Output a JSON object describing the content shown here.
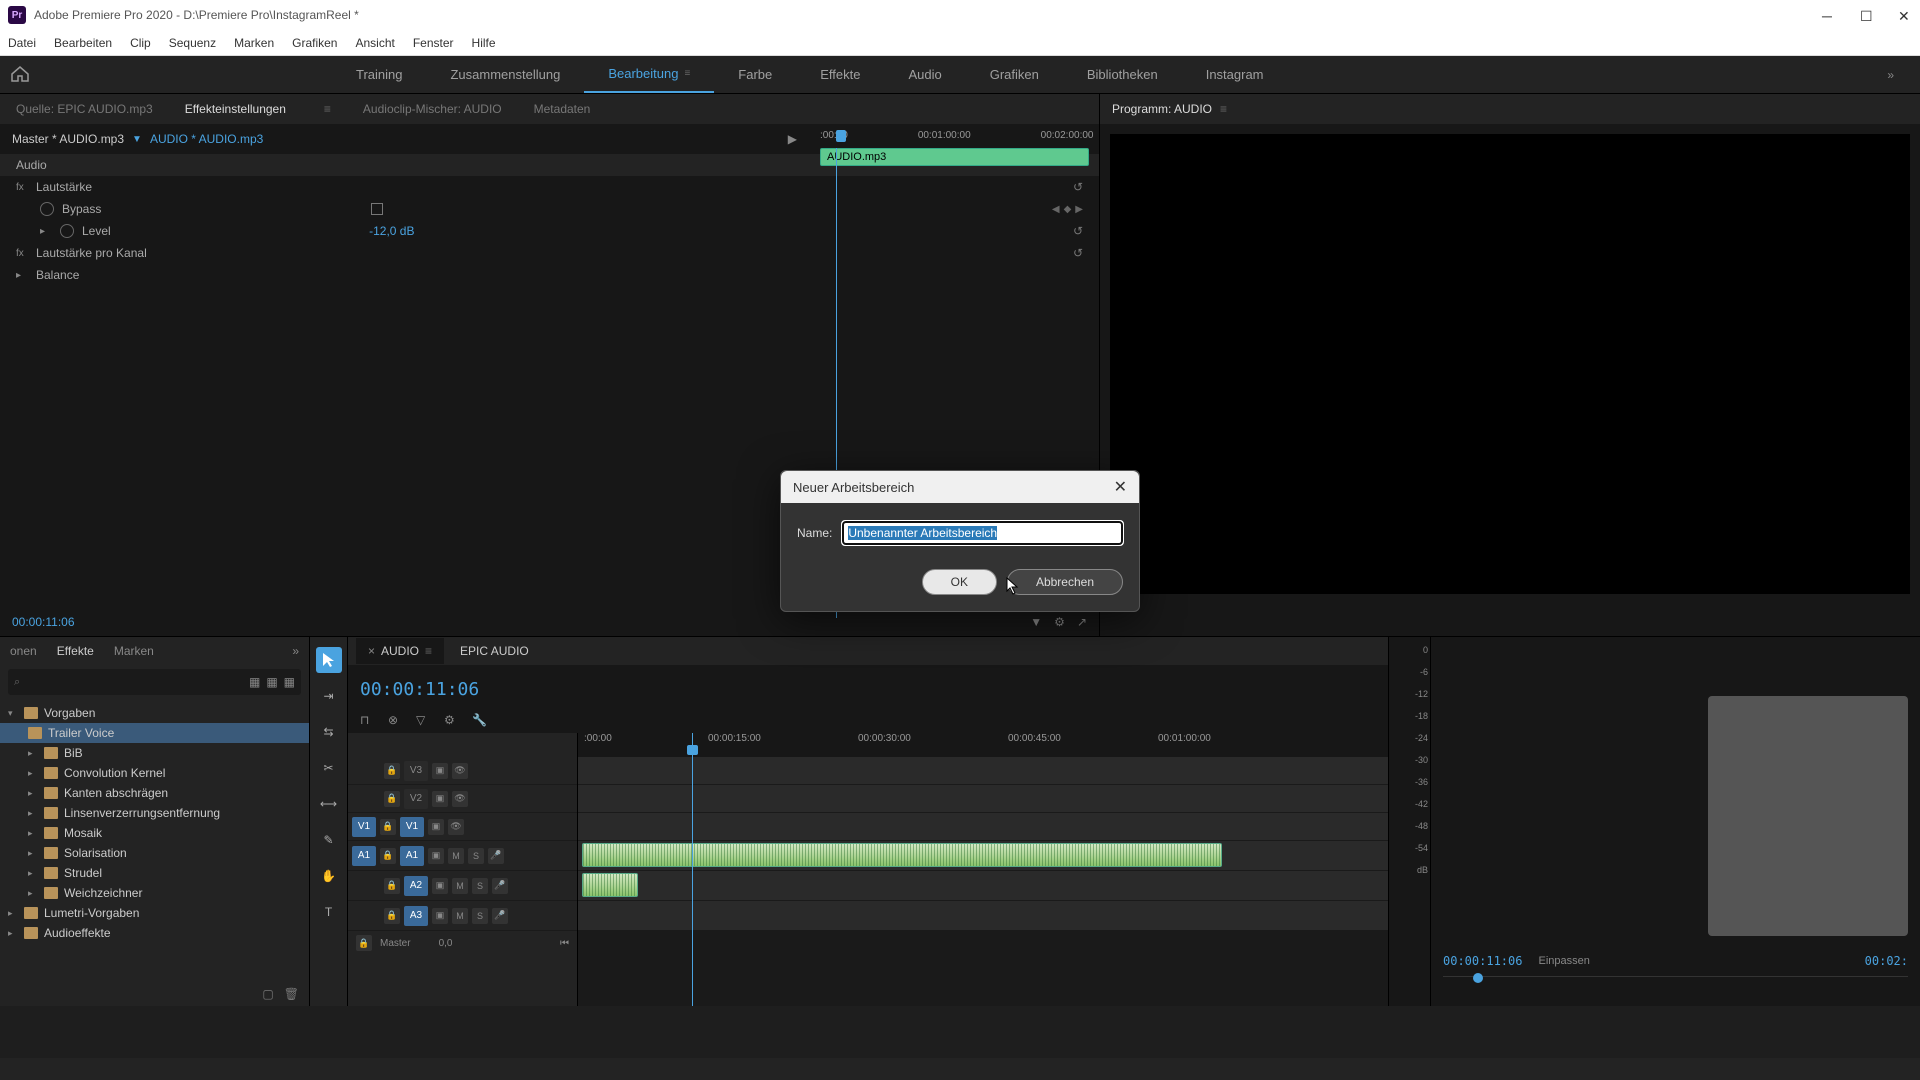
{
  "window": {
    "title": "Adobe Premiere Pro 2020 - D:\\Premiere Pro\\InstagramReel *",
    "logo": "Pr"
  },
  "menubar": [
    "Datei",
    "Bearbeiten",
    "Clip",
    "Sequenz",
    "Marken",
    "Grafiken",
    "Ansicht",
    "Fenster",
    "Hilfe"
  ],
  "workspaces": {
    "items": [
      {
        "label": "Training"
      },
      {
        "label": "Zusammenstellung"
      },
      {
        "label": "Bearbeitung",
        "active": true
      },
      {
        "label": "Farbe"
      },
      {
        "label": "Effekte"
      },
      {
        "label": "Audio"
      },
      {
        "label": "Grafiken"
      },
      {
        "label": "Bibliotheken"
      },
      {
        "label": "Instagram"
      }
    ]
  },
  "effect_panel": {
    "tabs": [
      "Quelle: EPIC AUDIO.mp3",
      "Effekteinstellungen",
      "Audioclip-Mischer: AUDIO",
      "Metadaten"
    ],
    "active_tab": 1,
    "master": "Master * AUDIO.mp3",
    "clip": "AUDIO * AUDIO.mp3",
    "section": "Audio",
    "params": {
      "volume": "Lautstärke",
      "bypass": "Bypass",
      "level": "Level",
      "level_value": "-12,0 dB",
      "channel_volume": "Lautstärke pro Kanal",
      "balance": "Balance"
    },
    "mini_timeline": {
      "labels": [
        ":00:00",
        "00:01:00:00",
        "00:02:00:00"
      ],
      "clip_name": "AUDIO.mp3"
    },
    "timecode": "00:00:11:06"
  },
  "program": {
    "title": "Programm: AUDIO",
    "timecode": "00:00:11:06",
    "fit": "Einpassen",
    "end_tc": "00:02:"
  },
  "project": {
    "tabs": [
      "onen",
      "Effekte",
      "Marken"
    ],
    "active_tab": 1,
    "tree": [
      {
        "label": "Vorgaben",
        "type": "folder",
        "open": true,
        "indent": 0
      },
      {
        "label": "Trailer Voice",
        "type": "folder",
        "indent": 1,
        "selected": true
      },
      {
        "label": "BiB",
        "type": "folder",
        "indent": 1
      },
      {
        "label": "Convolution Kernel",
        "type": "folder",
        "indent": 1
      },
      {
        "label": "Kanten abschrägen",
        "type": "folder",
        "indent": 1
      },
      {
        "label": "Linsenverzerrungsentfernung",
        "type": "folder",
        "indent": 1
      },
      {
        "label": "Mosaik",
        "type": "folder",
        "indent": 1
      },
      {
        "label": "Solarisation",
        "type": "folder",
        "indent": 1
      },
      {
        "label": "Strudel",
        "type": "folder",
        "indent": 1
      },
      {
        "label": "Weichzeichner",
        "type": "folder",
        "indent": 1
      },
      {
        "label": "Lumetri-Vorgaben",
        "type": "folder",
        "indent": 0
      },
      {
        "label": "Audioeffekte",
        "type": "folder",
        "indent": 0
      }
    ]
  },
  "timeline": {
    "sequences": [
      {
        "label": "AUDIO",
        "active": true
      },
      {
        "label": "EPIC AUDIO"
      }
    ],
    "timecode": "00:00:11:06",
    "ruler": [
      ":00:00",
      "00:00:15:00",
      "00:00:30:00",
      "00:00:45:00",
      "00:01:00:00"
    ],
    "tracks": {
      "video": [
        "V3",
        "V2",
        "V1"
      ],
      "audio": [
        "A1",
        "A2",
        "A3"
      ],
      "master": "Master",
      "master_val": "0,0"
    }
  },
  "meter_labels": [
    "0",
    "-6",
    "-12",
    "-18",
    "-24",
    "-30",
    "-36",
    "-42",
    "-48",
    "-54",
    "dB"
  ],
  "dialog": {
    "title": "Neuer Arbeitsbereich",
    "name_label": "Name:",
    "name_value": "Unbenannter Arbeitsbereich",
    "ok": "OK",
    "cancel": "Abbrechen"
  }
}
